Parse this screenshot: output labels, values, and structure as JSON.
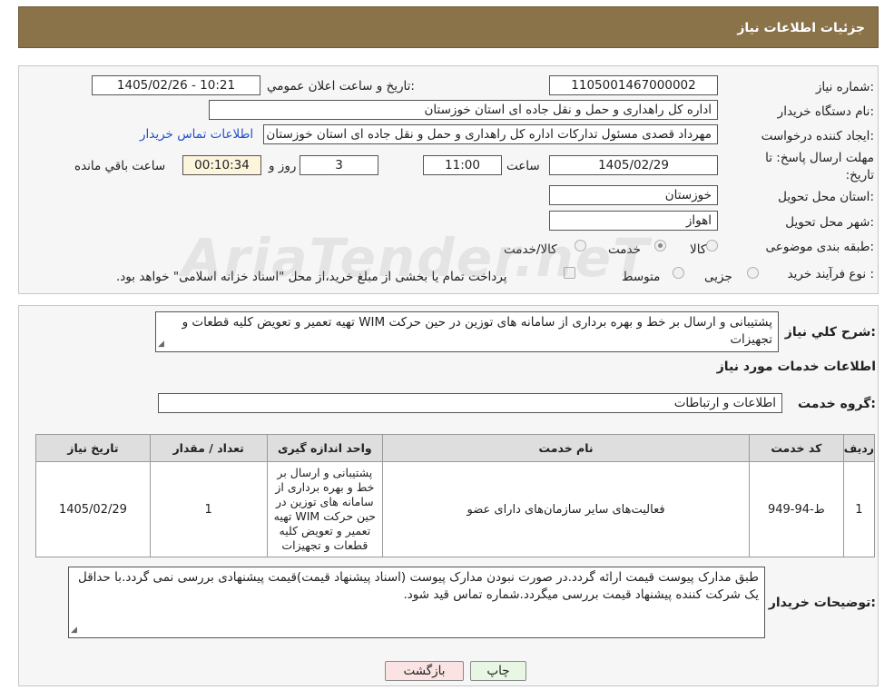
{
  "header": {
    "title": "جزئیات اطلاعات نیاز"
  },
  "form": {
    "need_number_label": "شماره نیاز:",
    "need_number": "1105001467000002",
    "announce_label": "تاریخ و ساعت اعلان عمومي:",
    "announce_value": "1405/02/26 - 10:21",
    "buyer_org_label": "نام دستگاه خریدار:",
    "buyer_org": "اداره کل راهداری و حمل و نقل جاده ای استان خوزستان",
    "creator_label": "ایجاد کننده درخواست:",
    "creator": "مهرداد قصدی مسئول تدارکات اداره کل راهداری و حمل و نقل جاده ای استان خوزستان",
    "contact_link": "اطلاعات تماس خریدار",
    "deadline_label": "مهلت ارسال پاسخ: تا تاریخ:",
    "deadline_date": "1405/02/29",
    "time_label": "ساعت",
    "deadline_time": "11:00",
    "days_value": "3",
    "days_label": "روز و",
    "remaining_time": "00:10:34",
    "remaining_label": "ساعت باقي مانده",
    "province_label": "استان محل تحویل:",
    "province": "خوزستان",
    "city_label": "شهر محل تحویل:",
    "city": "اهواز",
    "category_label": "طبقه بندی موضوعی:",
    "category_options": [
      "کالا",
      "خدمت",
      "کالا/خدمت"
    ],
    "category_selected": "خدمت",
    "process_label": "نوع فرآیند خرید :",
    "process_options": [
      "جزیی",
      "متوسط"
    ],
    "process_note": "پرداخت تمام یا بخشی از مبلغ خرید،از محل \"اسناد خزانه اسلامی\" خواهد بود."
  },
  "summary": {
    "label": "شرح کلي نیاز:",
    "text": "پشتیبانی و ارسال بر خط و بهره برداری از سامانه های توزین در حین حرکت WIM تهیه تعمیر و تعویض کلیه قطعات و تجهیزات",
    "services_title": "اطلاعات خدمات مورد نیاز",
    "group_label": "گروه خدمت:",
    "group_value": "اطلاعات و ارتباطات"
  },
  "table": {
    "headers": [
      "ردیف",
      "کد خدمت",
      "نام خدمت",
      "واحد اندازه گیری",
      "تعداد / مقدار",
      "تاریخ نیاز"
    ],
    "rows": [
      {
        "row": "1",
        "code": "ط-94-949",
        "name": "فعالیت‌های سایر سازمان‌های دارای عضو",
        "unit": "پشتیبانی و ارسال بر خط و بهره برداری از سامانه های توزین در حین حرکت WIM تهیه تعمیر و تعویض کلیه قطعات و تجهیزات",
        "qty": "1",
        "date": "1405/02/29"
      }
    ]
  },
  "buyer_notes": {
    "label": "توضیحات خریدار:",
    "text": "طبق مدارک پیوست قیمت ارائه گردد.در صورت نبودن مدارک پیوست (اسناد پیشنهاد قیمت)قیمت پیشنهادی بررسی نمی گردد.با حداقل یک شرکت کننده پیشنهاد قیمت بررسی میگردد.شماره تماس قید شود."
  },
  "buttons": {
    "print": "چاپ",
    "back": "بازگشت"
  },
  "colors": {
    "header_bg": "#8b7349",
    "link": "#1f4fd0",
    "print_bg": "#e8f7e4",
    "back_bg": "#fbe3e3"
  },
  "watermark": "AriaTender.neT"
}
